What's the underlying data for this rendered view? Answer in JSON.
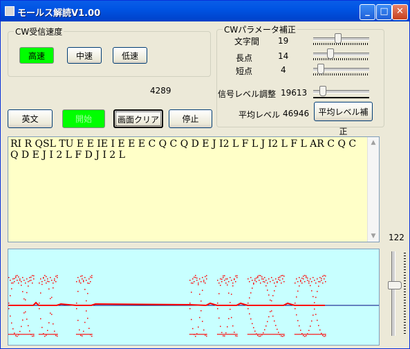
{
  "window": {
    "title": "モールス解読V1.00",
    "controls": {
      "minimize": "_",
      "maximize": "□",
      "close": "✕"
    }
  },
  "speed_group": {
    "legend": "CW受信速度",
    "buttons": [
      "高速",
      "中速",
      "低速"
    ]
  },
  "counter": "4289",
  "param_group": {
    "legend": "CWパラメータ補正",
    "rows": [
      {
        "label": "文字間",
        "value": "19",
        "level": 0.43
      },
      {
        "label": "長点",
        "value": "14",
        "level": 0.27
      },
      {
        "label": "短点",
        "value": "4",
        "level": 0.08
      }
    ],
    "signal_label": "信号レベル調整",
    "signal_value": "19613",
    "signal_level": 0.12,
    "avg_label": "平均レベル",
    "avg_value": "46946",
    "avg_button": "平均レベル補正"
  },
  "action_buttons": {
    "english": "英文",
    "start": "開始",
    "clear": "画面クリア",
    "stop": "停止"
  },
  "decoded_text": "RI R QSL TU E E IE I E E E C Q C Q D E J I2 L F L J I2 L F L AR C Q C Q D E J I 2 L F D J I 2 L",
  "side_value": "122",
  "side_level": 0.62,
  "colors": {
    "text_bg": "#ffffc8",
    "scope_bg": "#c8ffff",
    "active_green": "#00ff00",
    "signal_red": "#ff0000"
  }
}
